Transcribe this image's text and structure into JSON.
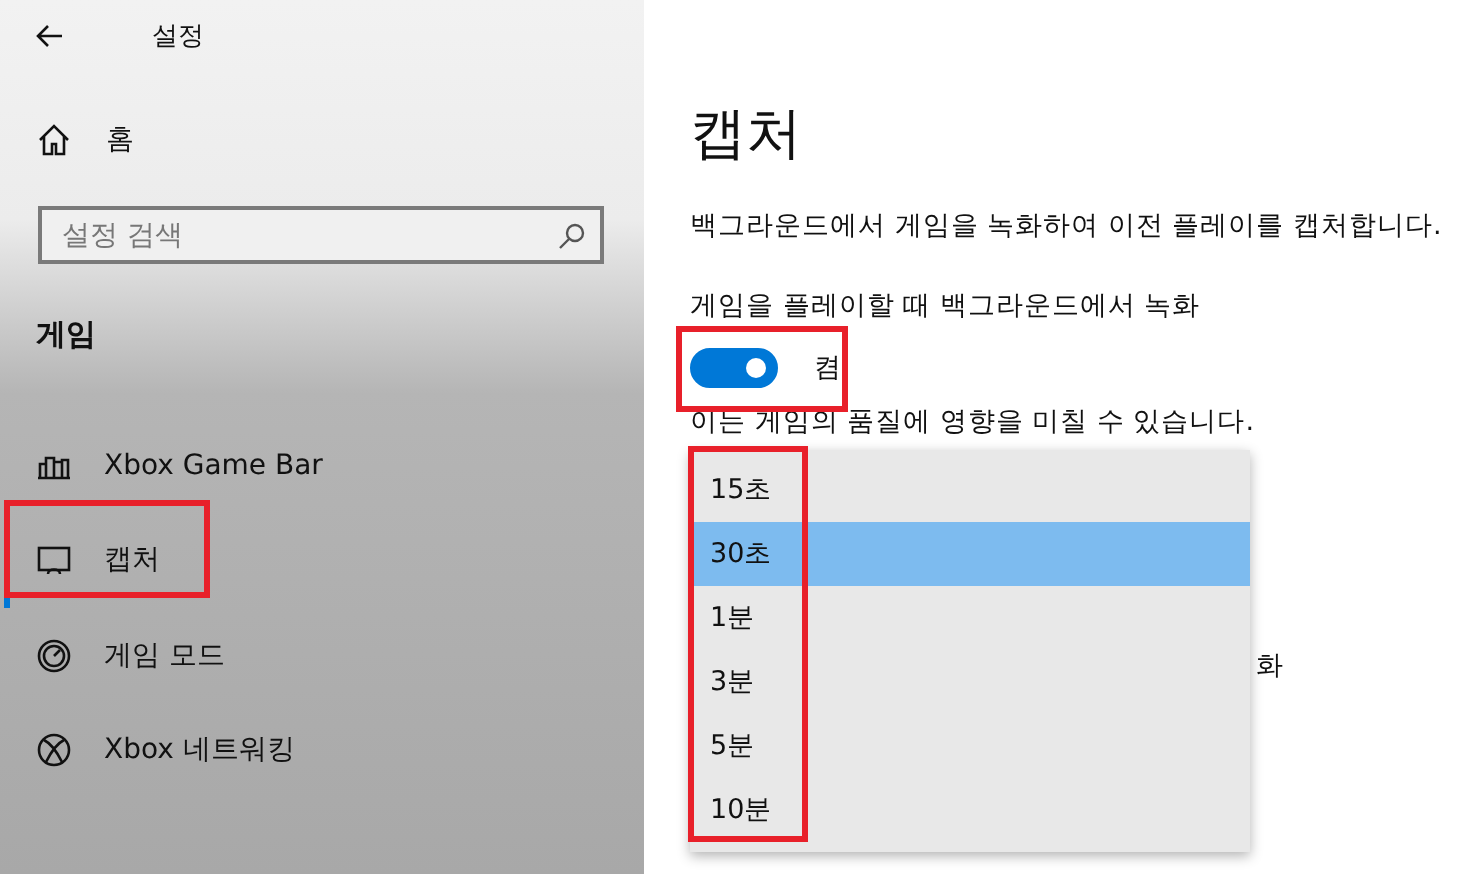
{
  "sidebar": {
    "title": "설정",
    "home": "홈",
    "search": {
      "placeholder": "설정 검색"
    },
    "section": "게임",
    "items": [
      {
        "label": "Xbox Game Bar",
        "kind": "gamebar",
        "selected": false
      },
      {
        "label": "캡처",
        "kind": "capture",
        "selected": true
      },
      {
        "label": "게임 모드",
        "kind": "gamemode",
        "selected": false
      },
      {
        "label": "Xbox 네트워킹",
        "kind": "xbox",
        "selected": false
      }
    ]
  },
  "content": {
    "title": "캡처",
    "description": "백그라운드에서 게임을 녹화하여 이전 플레이를 캡처합니다.",
    "setting_label": "게임을 플레이할 때 백그라운드에서 녹화",
    "toggle": {
      "on": true,
      "label": "켬"
    },
    "note": "이는 게임의 품질에 영향을 미칠 수 있습니다.",
    "hidden_line_end": "화"
  },
  "dropdown": {
    "options": [
      {
        "label": "15초",
        "selected": false
      },
      {
        "label": "30초",
        "selected": true
      },
      {
        "label": "1분",
        "selected": false
      },
      {
        "label": "3분",
        "selected": false
      },
      {
        "label": "5분",
        "selected": false
      },
      {
        "label": "10분",
        "selected": false
      }
    ]
  }
}
